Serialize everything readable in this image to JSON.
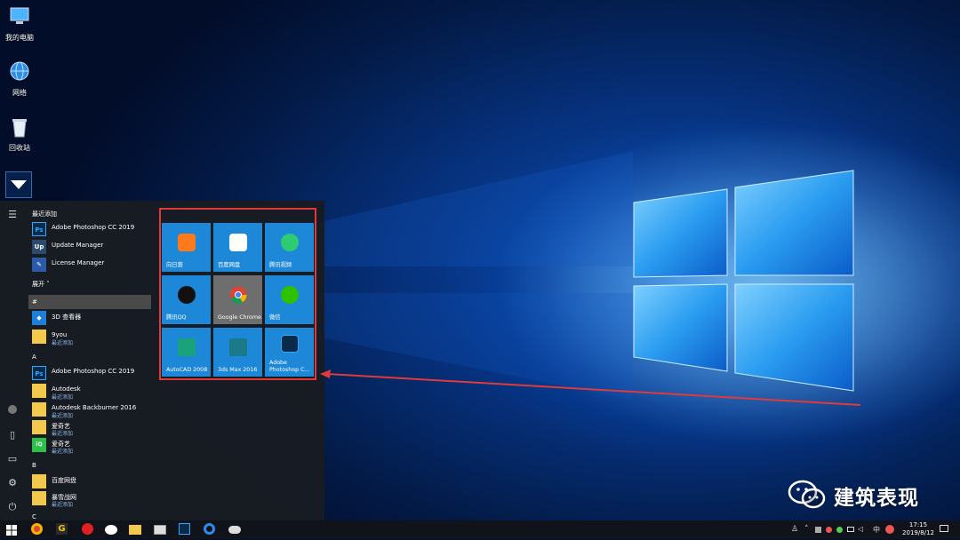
{
  "desktop_icons": [
    {
      "label": "我的电脑",
      "icon": "computer-icon"
    },
    {
      "label": "网络",
      "icon": "network-icon"
    },
    {
      "label": "回收站",
      "icon": "recycle-bin-icon"
    }
  ],
  "start_menu": {
    "recent_header": "最近添加",
    "recent": [
      {
        "label": "Adobe Photoshop CC 2019",
        "icon": "Ps"
      },
      {
        "label": "Update Manager",
        "icon": "Up"
      },
      {
        "label": "License Manager",
        "icon": "license-icon"
      }
    ],
    "expand_label": "展开",
    "search_hash": "#",
    "apps": [
      {
        "label": "3D 查看器",
        "sub": ""
      },
      {
        "label": "9you",
        "sub": "最近添加"
      },
      {
        "label": "A",
        "section": true
      },
      {
        "label": "Adobe Photoshop CC 2019",
        "sub": ""
      },
      {
        "label": "Autodesk",
        "sub": "最近添加"
      },
      {
        "label": "Autodesk Backburner 2016",
        "sub": "最近添加"
      },
      {
        "label": "爱奇艺",
        "sub": "最近添加"
      },
      {
        "label": "爱奇艺",
        "sub": "最近添加"
      },
      {
        "label": "B",
        "section": true
      },
      {
        "label": "百度网盘",
        "sub": ""
      },
      {
        "label": "暴雪战网",
        "sub": "最近添加"
      },
      {
        "label": "C",
        "section": true
      }
    ]
  },
  "tiles": [
    {
      "label": "向日葵",
      "color": "#ff7a1a",
      "icon": "sunflower-icon"
    },
    {
      "label": "百度网盘",
      "color": "#ffffff",
      "icon": "baidu-netdisk-icon"
    },
    {
      "label": "腾讯视频",
      "color": "#2ecc71",
      "icon": "tencent-video-icon"
    },
    {
      "label": "腾讯QQ",
      "color": "#111111",
      "icon": "qq-icon"
    },
    {
      "label": "Google Chrome",
      "color": "#757575",
      "icon": "chrome-icon"
    },
    {
      "label": "微信",
      "color": "#2dc100",
      "icon": "wechat-icon"
    },
    {
      "label": "AutoCAD 2008",
      "color": "#1aa37a",
      "icon": "autocad-icon"
    },
    {
      "label": "3ds Max 2016",
      "color": "#1a7a8a",
      "icon": "3dsmax-icon"
    },
    {
      "label": "Adobe\nPhotoshop C...",
      "color": "#0a2a4a",
      "icon": "photoshop-icon"
    }
  ],
  "taskbar": {
    "time": "17:15",
    "date": "2019/8/12",
    "ime": "中"
  },
  "watermark": {
    "text": "建筑表现"
  }
}
